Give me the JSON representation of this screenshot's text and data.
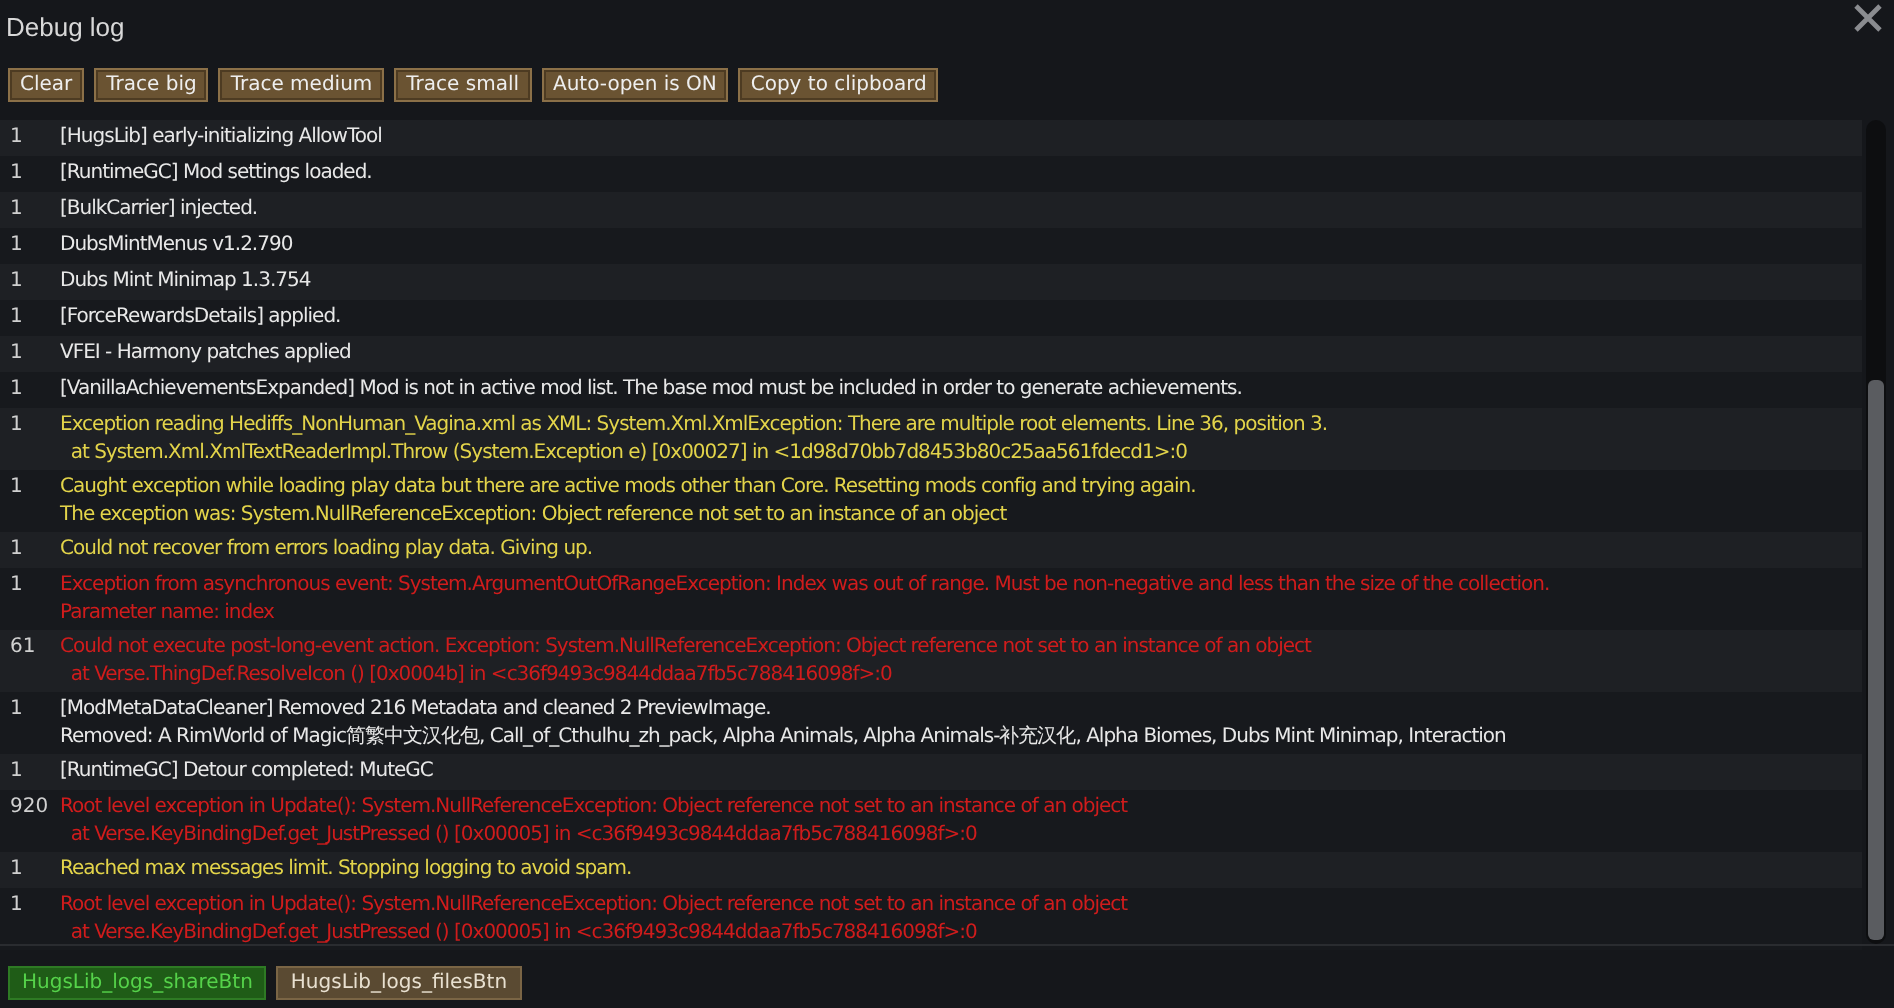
{
  "window": {
    "title": "Debug log"
  },
  "toolbar": [
    "Clear",
    "Trace big",
    "Trace medium",
    "Trace small",
    "Auto-open is ON",
    "Copy to clipboard"
  ],
  "log": [
    {
      "count": "1",
      "kind": "message",
      "lines": [
        "[HugsLib] early-initializing AllowTool"
      ]
    },
    {
      "count": "1",
      "kind": "message",
      "lines": [
        "[RuntimeGC] Mod settings loaded."
      ]
    },
    {
      "count": "1",
      "kind": "message",
      "lines": [
        "[BulkCarrier] injected."
      ]
    },
    {
      "count": "1",
      "kind": "message",
      "lines": [
        "DubsMintMenus v1.2.790"
      ]
    },
    {
      "count": "1",
      "kind": "message",
      "lines": [
        "Dubs Mint Minimap 1.3.754"
      ]
    },
    {
      "count": "1",
      "kind": "message",
      "lines": [
        "[ForceRewardsDetails] applied."
      ]
    },
    {
      "count": "1",
      "kind": "message",
      "lines": [
        "VFEI - Harmony patches applied"
      ]
    },
    {
      "count": "1",
      "kind": "message",
      "lines": [
        "[VanillaAchievementsExpanded] Mod is not in active mod list. The base mod must be included in order to generate achievements."
      ]
    },
    {
      "count": "1",
      "kind": "warning",
      "lines": [
        "Exception reading Hediffs_NonHuman_Vagina.xml as XML: System.Xml.XmlException: There are multiple root elements. Line 36, position 3.",
        "  at System.Xml.XmlTextReaderImpl.Throw (System.Exception e) [0x00027] in <1d98d70bb7d8453b80c25aa561fdecd1>:0"
      ]
    },
    {
      "count": "1",
      "kind": "warning",
      "lines": [
        "Caught exception while loading play data but there are active mods other than Core. Resetting mods config and trying again.",
        "The exception was: System.NullReferenceException: Object reference not set to an instance of an object"
      ]
    },
    {
      "count": "1",
      "kind": "warning",
      "lines": [
        "Could not recover from errors loading play data. Giving up."
      ]
    },
    {
      "count": "1",
      "kind": "error",
      "lines": [
        "Exception from asynchronous event: System.ArgumentOutOfRangeException: Index was out of range. Must be non-negative and less than the size of the collection.",
        "Parameter name: index"
      ]
    },
    {
      "count": "61",
      "kind": "error",
      "lines": [
        "Could not execute post-long-event action. Exception: System.NullReferenceException: Object reference not set to an instance of an object",
        "  at Verse.ThingDef.ResolveIcon () [0x0004b] in <c36f9493c9844ddaa7fb5c788416098f>:0"
      ]
    },
    {
      "count": "1",
      "kind": "message",
      "lines": [
        "[ModMetaDataCleaner] Removed 216 Metadata and cleaned 2 PreviewImage.",
        "Removed: A RimWorld of Magic简繁中文汉化包, Call_of_Cthulhu_zh_pack, Alpha Animals, Alpha Animals-补充汉化, Alpha Biomes, Dubs Mint Minimap, Interaction"
      ]
    },
    {
      "count": "1",
      "kind": "message",
      "lines": [
        "[RuntimeGC] Detour completed: MuteGC"
      ]
    },
    {
      "count": "920",
      "kind": "error",
      "lines": [
        "Root level exception in Update(): System.NullReferenceException: Object reference not set to an instance of an object",
        "  at Verse.KeyBindingDef.get_JustPressed () [0x00005] in <c36f9493c9844ddaa7fb5c788416098f>:0"
      ]
    },
    {
      "count": "1",
      "kind": "warning",
      "lines": [
        "Reached max messages limit. Stopping logging to avoid spam."
      ]
    },
    {
      "count": "1",
      "kind": "error",
      "lines": [
        "Root level exception in Update(): System.NullReferenceException: Object reference not set to an instance of an object",
        "  at Verse.KeyBindingDef.get_JustPressed () [0x00005] in <c36f9493c9844ddaa7fb5c788416098f>:0"
      ]
    }
  ],
  "footer": [
    {
      "label": "HugsLib_logs_shareBtn",
      "kind": "share"
    },
    {
      "label": "HugsLib_logs_filesBtn",
      "kind": "files"
    }
  ]
}
